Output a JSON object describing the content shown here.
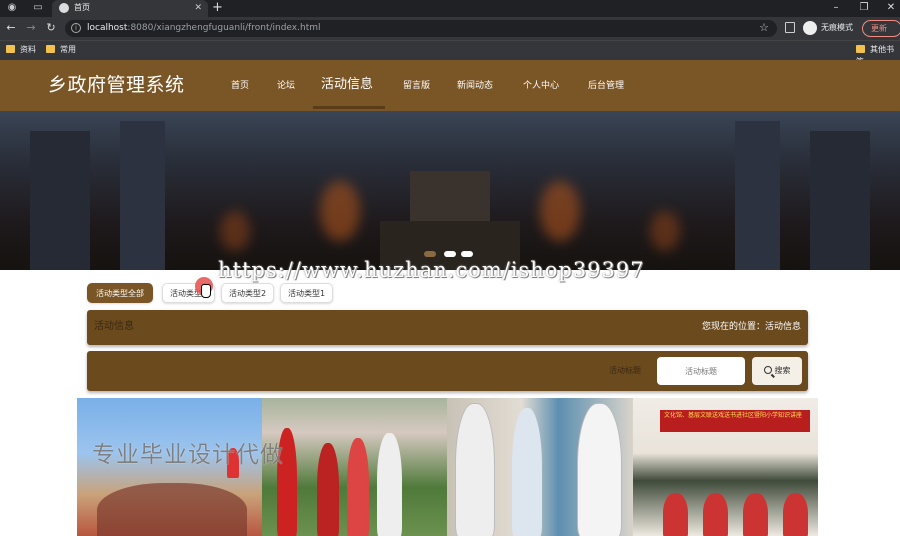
{
  "browser": {
    "tab_title": "首页",
    "url_host": "localhost",
    "url_rest": ":8080/xiangzhengfuguanli/front/index.html",
    "incognito_label": "无痕模式",
    "update_label": "更新",
    "bookmarks": [
      "资料",
      "常用"
    ],
    "other_bookmarks": "其他书签"
  },
  "site": {
    "title": "乡政府管理系统",
    "nav": [
      "首页",
      "论坛",
      "活动信息",
      "留言版",
      "新闻动态",
      "个人中心",
      "后台管理"
    ],
    "active_nav": "活动信息"
  },
  "watermark": "https://www.huzhan.com/ishop39397",
  "filters": [
    "活动类型全部",
    "活动类型3",
    "活动类型2",
    "活动类型1"
  ],
  "location": {
    "section_label": "活动信息",
    "breadcrumb": "您现在的位置：活动信息"
  },
  "search": {
    "label": "活动标题",
    "placeholder": "活动标题",
    "button_label": "搜索"
  },
  "photo_overlay_text": "专业毕业设计代做",
  "photo_banner_text": "文化馆、基层文联送戏送书进社区暨阳小学知识讲座",
  "colors": {
    "header": "#7a5525",
    "bars": "#6b4a1e"
  }
}
